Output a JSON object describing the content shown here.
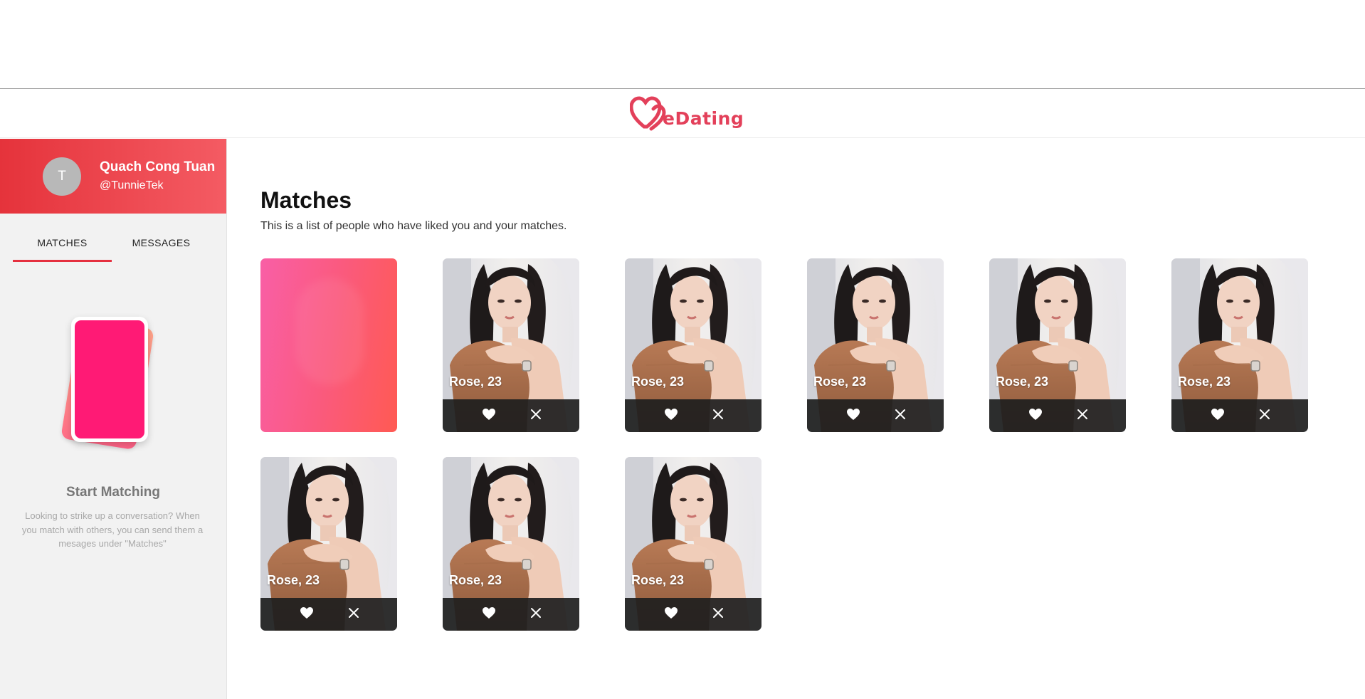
{
  "app": {
    "logo_text": "eDating",
    "brand_color": "#e3405a"
  },
  "profile": {
    "avatar_initial": "T",
    "name": "Quach Cong Tuan",
    "handle": "@TunnieTek"
  },
  "tabs": [
    {
      "label": "MATCHES",
      "active": true
    },
    {
      "label": "MESSAGES",
      "active": false
    }
  ],
  "sidebar": {
    "start_title": "Start Matching",
    "start_description": "Looking to strike up a conversation? When you match with others, you can send them a mesages under \"Matches\""
  },
  "main": {
    "title": "Matches",
    "subtitle": "This is a list of people who have liked you and your matches."
  },
  "matches": [
    {
      "kind": "blurred"
    },
    {
      "kind": "profile",
      "label": "Rose, 23",
      "like_icon": "heart-icon",
      "dismiss_icon": "close-icon"
    },
    {
      "kind": "profile",
      "label": "Rose, 23",
      "like_icon": "heart-icon",
      "dismiss_icon": "close-icon"
    },
    {
      "kind": "profile",
      "label": "Rose, 23",
      "like_icon": "heart-icon",
      "dismiss_icon": "close-icon"
    },
    {
      "kind": "profile",
      "label": "Rose, 23",
      "like_icon": "heart-icon",
      "dismiss_icon": "close-icon"
    },
    {
      "kind": "profile",
      "label": "Rose, 23",
      "like_icon": "heart-icon",
      "dismiss_icon": "close-icon"
    },
    {
      "kind": "profile",
      "label": "Rose, 23",
      "like_icon": "heart-icon",
      "dismiss_icon": "close-icon"
    },
    {
      "kind": "profile",
      "label": "Rose, 23",
      "like_icon": "heart-icon",
      "dismiss_icon": "close-icon"
    },
    {
      "kind": "profile",
      "label": "Rose, 23",
      "like_icon": "heart-icon",
      "dismiss_icon": "close-icon"
    }
  ]
}
